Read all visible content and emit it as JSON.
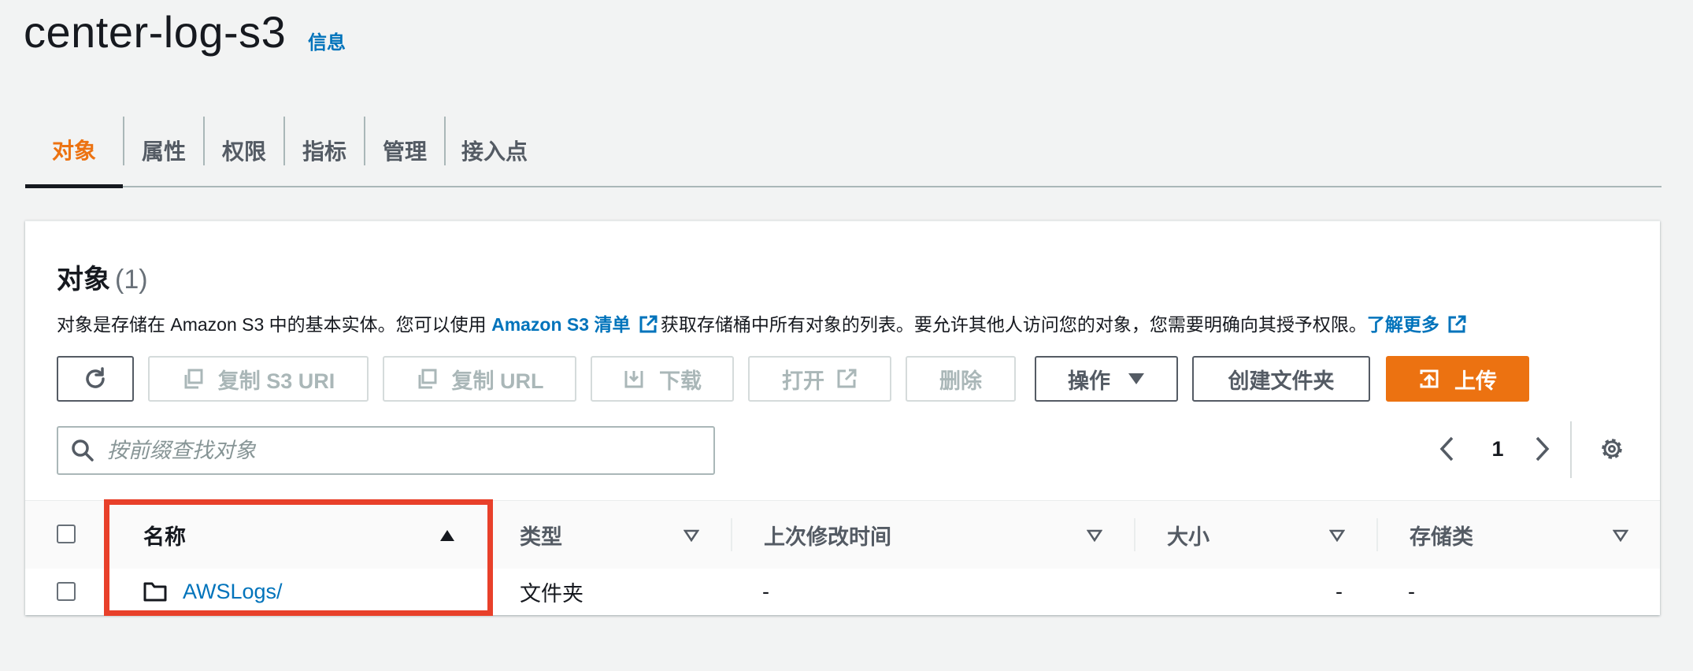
{
  "header": {
    "title": "center-log-s3",
    "info_link": "信息"
  },
  "tabs": [
    {
      "label": "对象",
      "active": true
    },
    {
      "label": "属性"
    },
    {
      "label": "权限"
    },
    {
      "label": "指标"
    },
    {
      "label": "管理"
    },
    {
      "label": "接入点"
    }
  ],
  "objects": {
    "title": "对象",
    "count": "(1)",
    "description": {
      "part1": "对象是存储在 Amazon S3 中的基本实体。您可以使用 ",
      "link1": "Amazon S3 清单",
      "part2": "获取存储桶中所有对象的列表。要允许其他人访问您的对象，您需要明确向其授予权限。",
      "link2": "了解更多"
    },
    "toolbar": {
      "copy_s3_uri": "复制 S3 URI",
      "copy_url": "复制 URL",
      "download": "下载",
      "open": "打开",
      "delete": "删除",
      "actions": "操作",
      "create_folder": "创建文件夹",
      "upload": "上传"
    },
    "search": {
      "placeholder": "按前缀查找对象",
      "value": ""
    },
    "pagination": {
      "current_page": "1"
    },
    "table": {
      "columns": [
        "名称",
        "类型",
        "上次修改时间",
        "大小",
        "存储类"
      ],
      "rows": [
        {
          "name": "AWSLogs/",
          "type": "文件夹",
          "last_modified": "-",
          "size": "-",
          "storage_class": "-"
        }
      ]
    }
  },
  "colors": {
    "accent": "#ec7211",
    "link": "#0073bb",
    "highlight": "#e8402a",
    "text": "#16191f"
  }
}
